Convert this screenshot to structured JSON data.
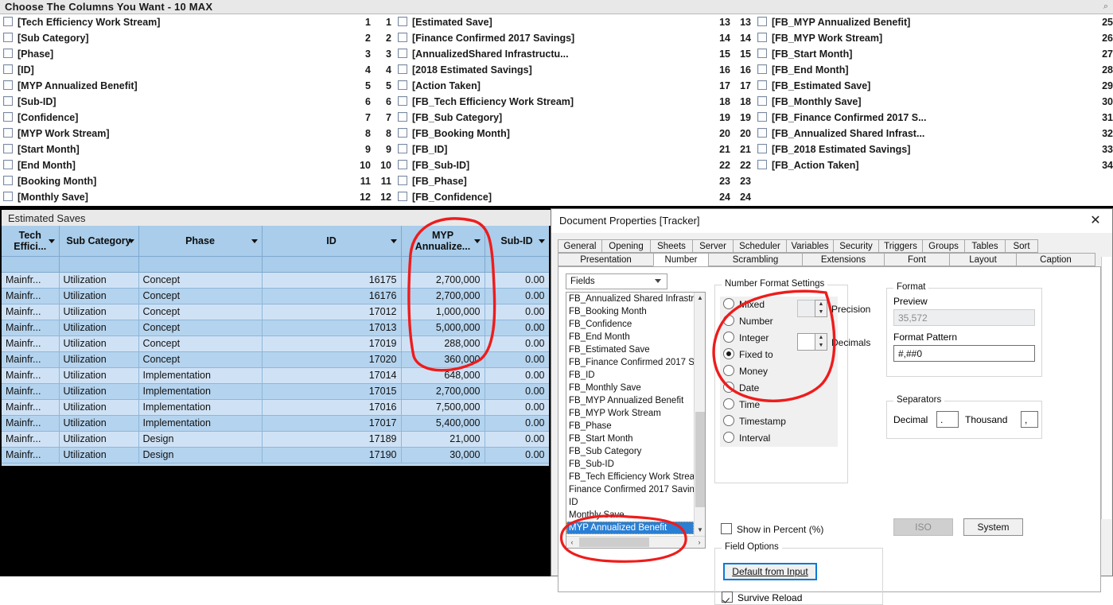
{
  "column_chooser": {
    "title": "Choose The Columns You Want - 10 MAX",
    "column1": [
      {
        "label": "[Tech Efficiency Work Stream]",
        "num": "1"
      },
      {
        "label": "[Sub Category]",
        "num": "2"
      },
      {
        "label": "[Phase]",
        "num": "3"
      },
      {
        "label": "[ID]",
        "num": "4"
      },
      {
        "label": "[MYP Annualized Benefit]",
        "num": "5"
      },
      {
        "label": "[Sub-ID]",
        "num": "6"
      },
      {
        "label": "[Confidence]",
        "num": "7"
      },
      {
        "label": "[MYP Work Stream]",
        "num": "8"
      },
      {
        "label": "[Start Month]",
        "num": "9"
      },
      {
        "label": "[End Month]",
        "num": "10"
      },
      {
        "label": "[Booking Month]",
        "num": "11"
      },
      {
        "label": "[Monthly Save]",
        "num": "12"
      }
    ],
    "column2": [
      {
        "numleft": "1",
        "label": "[Estimated Save]",
        "num": "13"
      },
      {
        "numleft": "2",
        "label": "[Finance Confirmed 2017 Savings]",
        "num": "14"
      },
      {
        "numleft": "3",
        "label": "[AnnualizedShared Infrastructu...",
        "num": "15"
      },
      {
        "numleft": "4",
        "label": "[2018 Estimated Savings]",
        "num": "16"
      },
      {
        "numleft": "5",
        "label": "[Action Taken]",
        "num": "17"
      },
      {
        "numleft": "6",
        "label": "[FB_Tech Efficiency Work Stream]",
        "num": "18"
      },
      {
        "numleft": "7",
        "label": "[FB_Sub Category]",
        "num": "19"
      },
      {
        "numleft": "8",
        "label": "[FB_Booking Month]",
        "num": "20"
      },
      {
        "numleft": "9",
        "label": "[FB_ID]",
        "num": "21"
      },
      {
        "numleft": "10",
        "label": "[FB_Sub-ID]",
        "num": "22"
      },
      {
        "numleft": "11",
        "label": "[FB_Phase]",
        "num": "23"
      },
      {
        "numleft": "12",
        "label": "[FB_Confidence]",
        "num": "24"
      }
    ],
    "column3": [
      {
        "numleft": "13",
        "label": "[FB_MYP Annualized Benefit]",
        "num": "25"
      },
      {
        "numleft": "14",
        "label": "[FB_MYP Work Stream]",
        "num": "26"
      },
      {
        "numleft": "15",
        "label": "[FB_Start Month]",
        "num": "27"
      },
      {
        "numleft": "16",
        "label": "[FB_End Month]",
        "num": "28"
      },
      {
        "numleft": "17",
        "label": "[FB_Estimated Save]",
        "num": "29"
      },
      {
        "numleft": "18",
        "label": "[FB_Monthly Save]",
        "num": "30"
      },
      {
        "numleft": "19",
        "label": "[FB_Finance Confirmed 2017 S...",
        "num": "31"
      },
      {
        "numleft": "20",
        "label": "[FB_Annualized Shared Infrast...",
        "num": "32"
      },
      {
        "numleft": "21",
        "label": "[FB_2018 Estimated Savings]",
        "num": "33"
      },
      {
        "numleft": "22",
        "label": "[FB_Action Taken]",
        "num": "34"
      },
      {
        "numleft": "23",
        "label": "",
        "num": ""
      },
      {
        "numleft": "24",
        "label": "",
        "num": ""
      }
    ]
  },
  "grid": {
    "caption": "Estimated Saves",
    "headers": [
      "Tech Effici...",
      "Sub Category",
      "Phase",
      "ID",
      "MYP Annualize...",
      "Sub-ID"
    ],
    "rows": [
      [
        "Mainfr...",
        "Utilization",
        "Concept",
        "16175",
        "2,700,000",
        "0.00"
      ],
      [
        "Mainfr...",
        "Utilization",
        "Concept",
        "16176",
        "2,700,000",
        "0.00"
      ],
      [
        "Mainfr...",
        "Utilization",
        "Concept",
        "17012",
        "1,000,000",
        "0.00"
      ],
      [
        "Mainfr...",
        "Utilization",
        "Concept",
        "17013",
        "5,000,000",
        "0.00"
      ],
      [
        "Mainfr...",
        "Utilization",
        "Concept",
        "17019",
        "288,000",
        "0.00"
      ],
      [
        "Mainfr...",
        "Utilization",
        "Concept",
        "17020",
        "360,000",
        "0.00"
      ],
      [
        "Mainfr...",
        "Utilization",
        "Implementation",
        "17014",
        "648,000",
        "0.00"
      ],
      [
        "Mainfr...",
        "Utilization",
        "Implementation",
        "17015",
        "2,700,000",
        "0.00"
      ],
      [
        "Mainfr...",
        "Utilization",
        "Implementation",
        "17016",
        "7,500,000",
        "0.00"
      ],
      [
        "Mainfr...",
        "Utilization",
        "Implementation",
        "17017",
        "5,400,000",
        "0.00"
      ],
      [
        "Mainfr...",
        "Utilization",
        "Design",
        "17189",
        "21,000",
        "0.00"
      ],
      [
        "Mainfr...",
        "Utilization",
        "Design",
        "17190",
        "30,000",
        "0.00"
      ]
    ]
  },
  "dialog": {
    "title": "Document Properties [Tracker]",
    "close_label": "✕",
    "tabs_row1": [
      "General",
      "Opening",
      "Sheets",
      "Server",
      "Scheduler",
      "Variables",
      "Security",
      "Triggers",
      "Groups",
      "Tables",
      "Sort"
    ],
    "tabs_row2": [
      "Presentation",
      "Number",
      "Scrambling",
      "Extensions",
      "Font",
      "Layout",
      "Caption"
    ],
    "active_tab": "Number",
    "field_combo": {
      "value": "Fields"
    },
    "field_list": {
      "items": [
        "FB_Annualized Shared Infrastru",
        "FB_Booking Month",
        "FB_Confidence",
        "FB_End Month",
        "FB_Estimated Save",
        "FB_Finance Confirmed 2017 S",
        "FB_ID",
        "FB_Monthly Save",
        "FB_MYP Annualized Benefit",
        "FB_MYP Work Stream",
        "FB_Phase",
        "FB_Start Month",
        "FB_Sub Category",
        "FB_Sub-ID",
        "FB_Tech Efficiency Work Strea",
        "Finance Confirmed 2017 Savin",
        "ID",
        "Monthly Save",
        "MYP Annualized Benefit"
      ],
      "selected": "MYP Annualized Benefit",
      "scroll_up_icon": "▲",
      "scroll_down_icon": "▼",
      "scroll_left_icon": "‹",
      "scroll_right_icon": "›"
    },
    "number_format": {
      "group_title": "Number Format Settings",
      "options": [
        "Mixed",
        "Number",
        "Integer",
        "Fixed to",
        "Money",
        "Date",
        "Time",
        "Timestamp",
        "Interval"
      ],
      "selected": "Fixed to",
      "precision_label": "Precision",
      "precision_value": "",
      "decimals_label": "Decimals",
      "decimals_value": "",
      "show_percent_label": "Show in Percent (%)",
      "show_percent_checked": false,
      "spin_up_icon": "▲",
      "spin_down_icon": "▼"
    },
    "format": {
      "group_title": "Format",
      "preview_label": "Preview",
      "preview_value": "35,572",
      "pattern_label": "Format Pattern",
      "pattern_value": "#,##0"
    },
    "separators": {
      "group_title": "Separators",
      "decimal_label": "Decimal",
      "decimal_value": ".",
      "thousand_label": "Thousand",
      "thousand_value": ","
    },
    "buttons": {
      "iso": "ISO",
      "system": "System"
    },
    "field_options": {
      "group_title": "Field Options",
      "default_from_input": "Default from Input",
      "survive_reload": "Survive Reload",
      "survive_reload_checked": true
    }
  },
  "annotations": {
    "color": "#ee1c1c",
    "marks": [
      "ellipse-around-myp-column",
      "ellipse-around-number-format-options",
      "ellipse-around-selected-field"
    ]
  },
  "misc": {
    "top_right_icon": "⌕"
  }
}
